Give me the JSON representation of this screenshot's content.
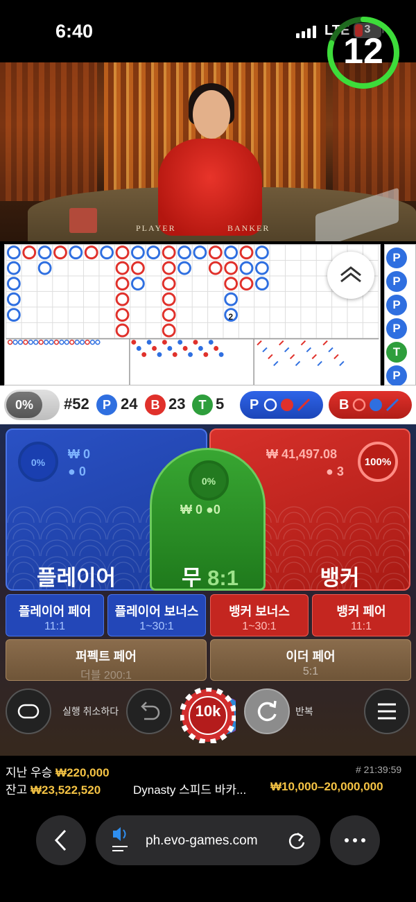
{
  "status_bar": {
    "time": "6:40",
    "network": "LTE",
    "battery": "3"
  },
  "video": {
    "timer": "12",
    "table_left_label": "PLAYER",
    "table_right_label": "BANKER"
  },
  "stats": {
    "percent_toggle": "0%",
    "round": "#52",
    "player_badge": "P",
    "player_count": "24",
    "banker_badge": "B",
    "banker_count": "23",
    "tie_badge": "T",
    "tie_count": "5",
    "player_predict": "P",
    "banker_predict": "B"
  },
  "road_side_labels": [
    "P",
    "P",
    "P",
    "P",
    "T",
    "P"
  ],
  "player_spot": {
    "percent": "0%",
    "amount": "₩ 0",
    "players": "0",
    "title": "플레이어"
  },
  "tie_spot": {
    "percent": "0%",
    "amount": "₩ 0",
    "players": "0",
    "title": "무",
    "payout": "8:1"
  },
  "banker_spot": {
    "percent": "100%",
    "amount": "₩ 41,497.08",
    "players": "3",
    "title": "뱅커"
  },
  "side_bets": [
    {
      "title": "플레이어 페어",
      "payout": "11:1"
    },
    {
      "title": "플레이어 보너스",
      "payout": "1~30:1"
    },
    {
      "title": "뱅커 보너스",
      "payout": "1~30:1"
    },
    {
      "title": "뱅커 페어",
      "payout": "11:1"
    }
  ],
  "wide_bets": [
    {
      "title": "퍼펙트 페어",
      "payout": "더블 200:1"
    },
    {
      "title": "이더 페어",
      "payout": "5:1"
    }
  ],
  "controls": {
    "undo_label": "실행 취소하다",
    "chip_value": "10k",
    "repeat_label": "반복"
  },
  "footer": {
    "last_win_label": "지난 우승",
    "last_win_value": "₩220,000",
    "game_id": "# 21:39:59",
    "balance_label": "잔고",
    "balance_value": "₩23,522,520",
    "table_name": "Dynasty 스피드 바카...",
    "limits": "₩10,000–20,000,000"
  },
  "browser": {
    "url": "ph.evo-games.com"
  },
  "colors": {
    "player": "#2f6fe0",
    "banker": "#e0312b",
    "tie": "#2e9e3c",
    "gold": "#f5c344"
  }
}
